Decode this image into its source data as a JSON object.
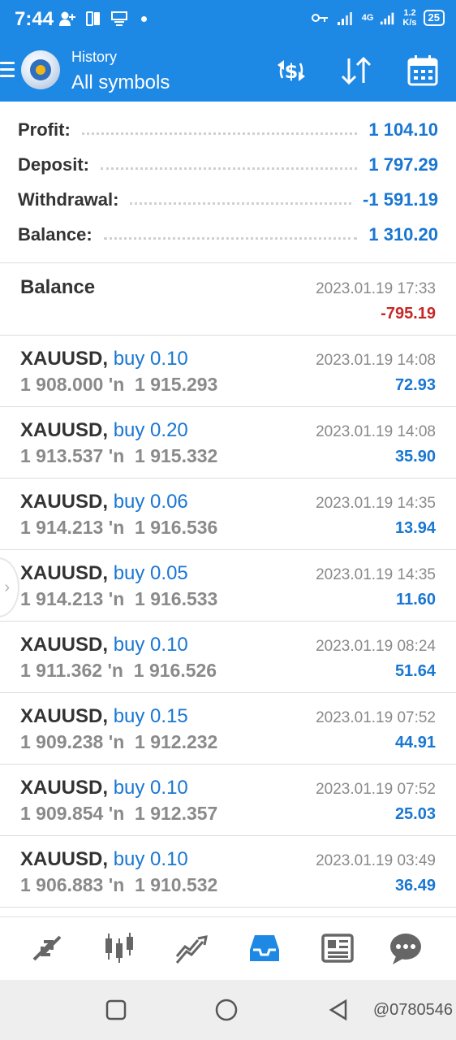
{
  "status_bar": {
    "time": "7:44",
    "network_type": "4G",
    "speed_value": "1.2",
    "speed_unit": "K/s",
    "battery": "25"
  },
  "header": {
    "subtitle": "History",
    "title": "All symbols",
    "icons": [
      "menu-icon",
      "metatrader-logo",
      "currency-swap-icon",
      "sort-icon",
      "calendar-icon"
    ]
  },
  "summary": [
    {
      "label": "Profit:",
      "value": "1 104.10"
    },
    {
      "label": "Deposit:",
      "value": "1 797.29"
    },
    {
      "label": "Withdrawal:",
      "value": "-1 591.19"
    },
    {
      "label": "Balance:",
      "value": "1 310.20"
    }
  ],
  "balance_entry": {
    "title": "Balance",
    "datetime": "2023.01.19 17:33",
    "amount": "-795.19"
  },
  "trades": [
    {
      "symbol": "XAUUSD,",
      "side": "buy 0.10",
      "open": "1 908.000",
      "arrow": "'n",
      "close": "1 915.293",
      "datetime": "2023.01.19 14:08",
      "profit": "72.93"
    },
    {
      "symbol": "XAUUSD,",
      "side": "buy 0.20",
      "open": "1 913.537",
      "arrow": "'n",
      "close": "1 915.332",
      "datetime": "2023.01.19 14:08",
      "profit": "35.90"
    },
    {
      "symbol": "XAUUSD,",
      "side": "buy 0.06",
      "open": "1 914.213",
      "arrow": "'n",
      "close": "1 916.536",
      "datetime": "2023.01.19 14:35",
      "profit": "13.94"
    },
    {
      "symbol": "XAUUSD,",
      "side": "buy 0.05",
      "open": "1 914.213",
      "arrow": "'n",
      "close": "1 916.533",
      "datetime": "2023.01.19 14:35",
      "profit": "11.60"
    },
    {
      "symbol": "XAUUSD,",
      "side": "buy 0.10",
      "open": "1 911.362",
      "arrow": "'n",
      "close": "1 916.526",
      "datetime": "2023.01.19 08:24",
      "profit": "51.64"
    },
    {
      "symbol": "XAUUSD,",
      "side": "buy 0.15",
      "open": "1 909.238",
      "arrow": "'n",
      "close": "1 912.232",
      "datetime": "2023.01.19 07:52",
      "profit": "44.91"
    },
    {
      "symbol": "XAUUSD,",
      "side": "buy 0.10",
      "open": "1 909.854",
      "arrow": "'n",
      "close": "1 912.357",
      "datetime": "2023.01.19 07:52",
      "profit": "25.03"
    },
    {
      "symbol": "XAUUSD,",
      "side": "buy 0.10",
      "open": "1 906.883",
      "arrow": "'n",
      "close": "1 910.532",
      "datetime": "2023.01.19 03:49",
      "profit": "36.49"
    }
  ],
  "bottom_nav": {
    "items": [
      "quotes-icon",
      "chart-icon",
      "trade-icon",
      "history-icon",
      "news-icon",
      "chat-icon"
    ],
    "active": "history-icon",
    "active_color": "#1e88e5"
  },
  "colors": {
    "brand": "#1e88e5",
    "positive": "#1976d2",
    "negative": "#c62828"
  },
  "watermark": "@0780546"
}
